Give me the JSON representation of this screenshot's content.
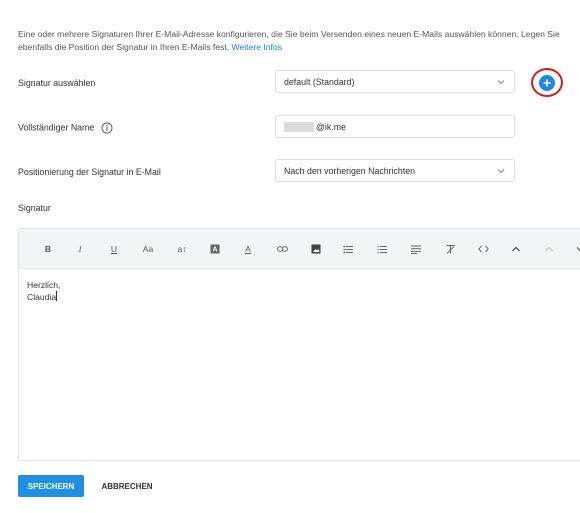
{
  "intro": {
    "text": "Eine oder mehrere Signaturen Ihrer E-Mail-Adresse konfigurieren, die Sie beim Versenden eines neuen E-Mails auswählen können. Legen Sie ebenfalls die Position der Signatur in Ihren E-Mails fest.",
    "link": "Weitere Infos"
  },
  "signature_select": {
    "label": "Signatur auswählen",
    "value": "default (Standard)"
  },
  "full_name": {
    "label": "Vollständiger Name",
    "value_suffix": "@ik.me"
  },
  "position": {
    "label": "Positionierung der Signatur in E-Mail",
    "value": "Nach den vorherigen Nachrichten"
  },
  "editor": {
    "label": "Signatur",
    "toolbar": {
      "bold": "B",
      "italic": "I",
      "underline": "U",
      "font_size": "Aa",
      "line_height": "a↕",
      "bg_color": "A",
      "text_color": "A",
      "link": "∞",
      "image": "▲",
      "bullet_list": "☰",
      "numbered_list": "☰",
      "align": "≡",
      "clear_format": "T",
      "code": "‹›",
      "undo": "⌒",
      "redo": "⌒"
    },
    "lines": [
      "Herzlich,",
      "Claudia"
    ]
  },
  "buttons": {
    "save": "SPEICHERN",
    "cancel": "ABBRECHEN"
  },
  "colors": {
    "accent": "#1e8fe1",
    "highlight": "#d71a1a"
  },
  "icons": {
    "add": "plus-circle-icon",
    "info": "info-icon",
    "chevron": "chevron-down-icon"
  }
}
